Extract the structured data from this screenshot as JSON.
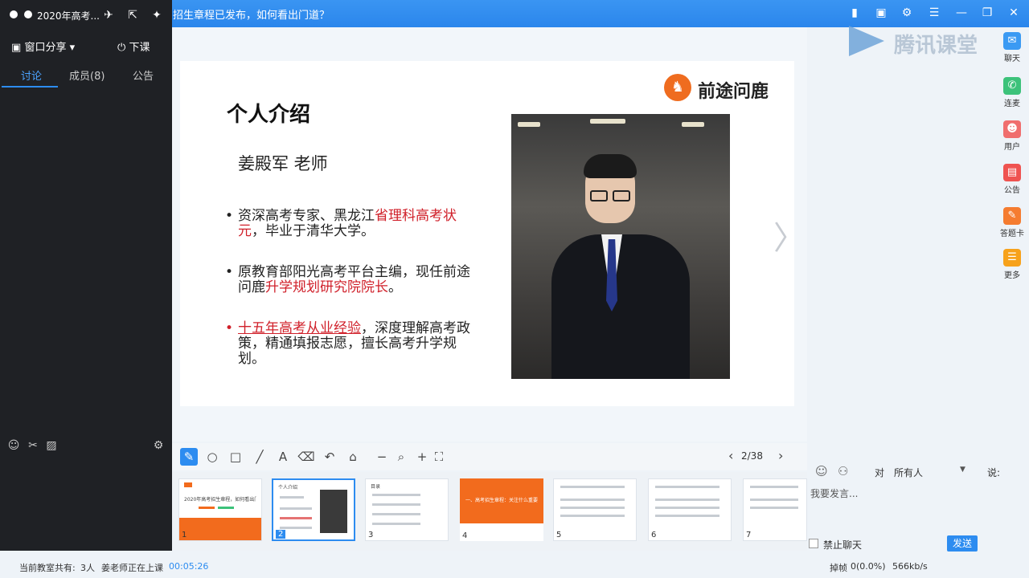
{
  "window": {
    "title": "招生章程已发布，如何看出门道？"
  },
  "left_panel": {
    "class_title": "2020年高考...",
    "share_label": "窗口分享",
    "end_class_label": "下课",
    "tabs": [
      {
        "label": "讨论"
      },
      {
        "label": "成员(8)"
      },
      {
        "label": "公告"
      }
    ]
  },
  "slide": {
    "brand": "前途问鹿",
    "heading": "个人介绍",
    "teacher_name": "姜殿军 老师",
    "bullets": [
      {
        "pre": "资深高考专家、黑龙江",
        "red": "省理科高考状元",
        "post": "，毕业于清华大学。"
      },
      {
        "pre": "原教育部阳光高考平台主编，现任前途问鹿",
        "red": "升学规划研究院院长",
        "post": "。"
      },
      {
        "pre": "",
        "red": "十五年高考从业经验",
        "post": "，深度理解高考政策，精通填报志愿，擅长高考升学规划。"
      }
    ]
  },
  "toolbar": {
    "page_indicator": "2/38"
  },
  "thumbnails": [
    {
      "num": "1",
      "title": "2020年高考招生章程，如何看出门道"
    },
    {
      "num": "2",
      "title": "个人介绍"
    },
    {
      "num": "3",
      "title": "目录"
    },
    {
      "num": "4",
      "title": "一、高考招生章程：关注什么重要"
    },
    {
      "num": "5",
      "title": ""
    },
    {
      "num": "6",
      "title": ""
    },
    {
      "num": "7",
      "title": ""
    }
  ],
  "brand_watermark": "腾讯课堂",
  "right_sidebar": [
    {
      "label": "聊天",
      "icon": "chat-icon",
      "color": "#3b9af3"
    },
    {
      "label": "连麦",
      "icon": "phone-icon",
      "color": "#3cc27a"
    },
    {
      "label": "用户",
      "icon": "user-icon",
      "color": "#f06e6e"
    },
    {
      "label": "公告",
      "icon": "notice-icon",
      "color": "#ef5350"
    },
    {
      "label": "答题卡",
      "icon": "answer-card-icon",
      "color": "#f57c30"
    },
    {
      "label": "更多",
      "icon": "more-icon",
      "color": "#f7a21b"
    }
  ],
  "chat": {
    "to_label": "对",
    "recipient": "所有人",
    "say_label": "说:",
    "placeholder": "我要发言...",
    "ban_label": "禁止聊天",
    "send_label": "发送"
  },
  "status": {
    "room_count_label": "当前教室共有:",
    "room_count": "3人",
    "teacher_status": "姜老师正在上课",
    "elapsed": "00:05:26",
    "drop_frames_label": "掉帧",
    "drop_frames": "0(0.0%)",
    "bandwidth": "566kb/s"
  }
}
